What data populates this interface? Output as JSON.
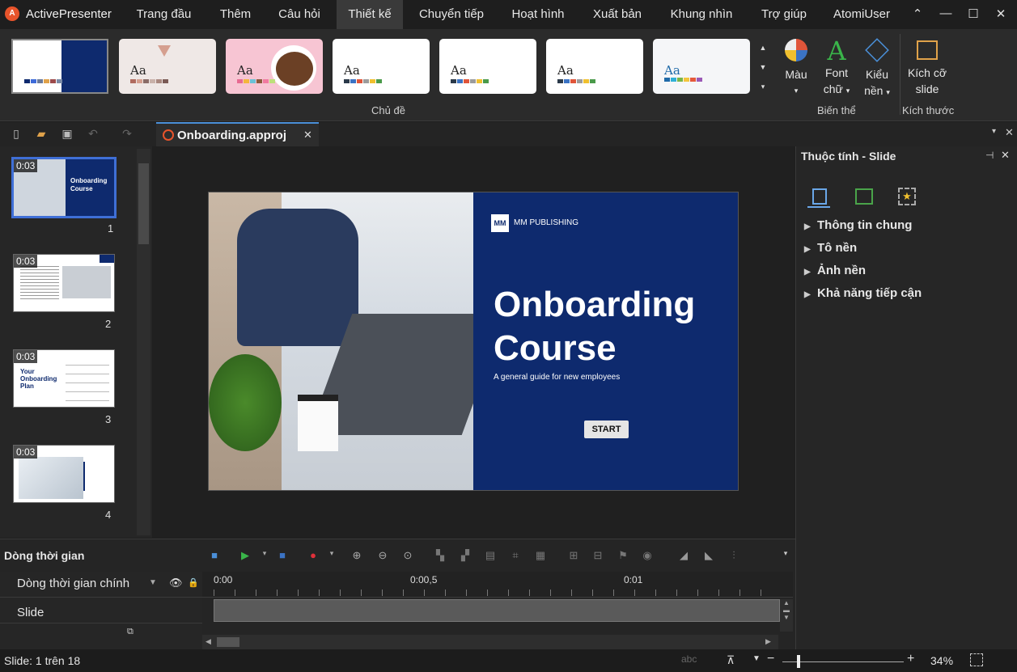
{
  "app": {
    "logo": "A",
    "name": "ActivePresenter"
  },
  "menu": [
    {
      "label": "Trang đầu"
    },
    {
      "label": "Thêm"
    },
    {
      "label": "Câu hỏi"
    },
    {
      "label": "Thiết kế"
    },
    {
      "label": "Chuyển tiếp"
    },
    {
      "label": "Hoạt hình"
    },
    {
      "label": "Xuất bản"
    },
    {
      "label": "Khung nhìn"
    },
    {
      "label": "Trợ giúp"
    },
    {
      "label": "AtomiUser"
    }
  ],
  "window_controls": {
    "collapse": "⌃",
    "minimize": "—",
    "maximize": "☐",
    "close": "✕"
  },
  "ribbon": {
    "theme_sample": "Aa",
    "themes_group_label": "Chủ đề",
    "color_label": "Màu",
    "font_label_1": "Font",
    "font_label_2": "chữ",
    "bg_style_label_1": "Kiểu",
    "bg_style_label_2": "nền",
    "variants_group_label": "Biến thể",
    "slide_size_label_1": "Kích cỡ",
    "slide_size_label_2": "slide",
    "size_group_label": "Kích thước"
  },
  "document": {
    "tab_label": "Onboarding.approj",
    "close": "✕"
  },
  "slides": [
    {
      "time": "0:03",
      "number": "1"
    },
    {
      "time": "0:03",
      "number": "2"
    },
    {
      "time": "0:03",
      "number": "3"
    },
    {
      "time": "0:03",
      "number": "4"
    }
  ],
  "thumb_text": {
    "t1_title": "Onboarding Course",
    "t3_title": "Your Onboarding Plan"
  },
  "slide": {
    "publisher": "MM PUBLISHING",
    "logo_text": "MM",
    "title_line1": "Onboarding",
    "title_line2": "Course",
    "subtitle": "A general guide for new employees",
    "button": "START"
  },
  "properties": {
    "title": "Thuộc tính - Slide",
    "sections": [
      "Thông tin chung",
      "Tô nền",
      "Ảnh nền",
      "Khả năng tiếp cận"
    ]
  },
  "timeline": {
    "title": "Dòng thời gian",
    "main_label": "Dòng thời gian chính",
    "slide_row": "Slide",
    "ticks": [
      "0:00",
      "0:00,5",
      "0:01"
    ]
  },
  "status": {
    "text": "Slide: 1 trên 18",
    "zoom": "34%"
  }
}
